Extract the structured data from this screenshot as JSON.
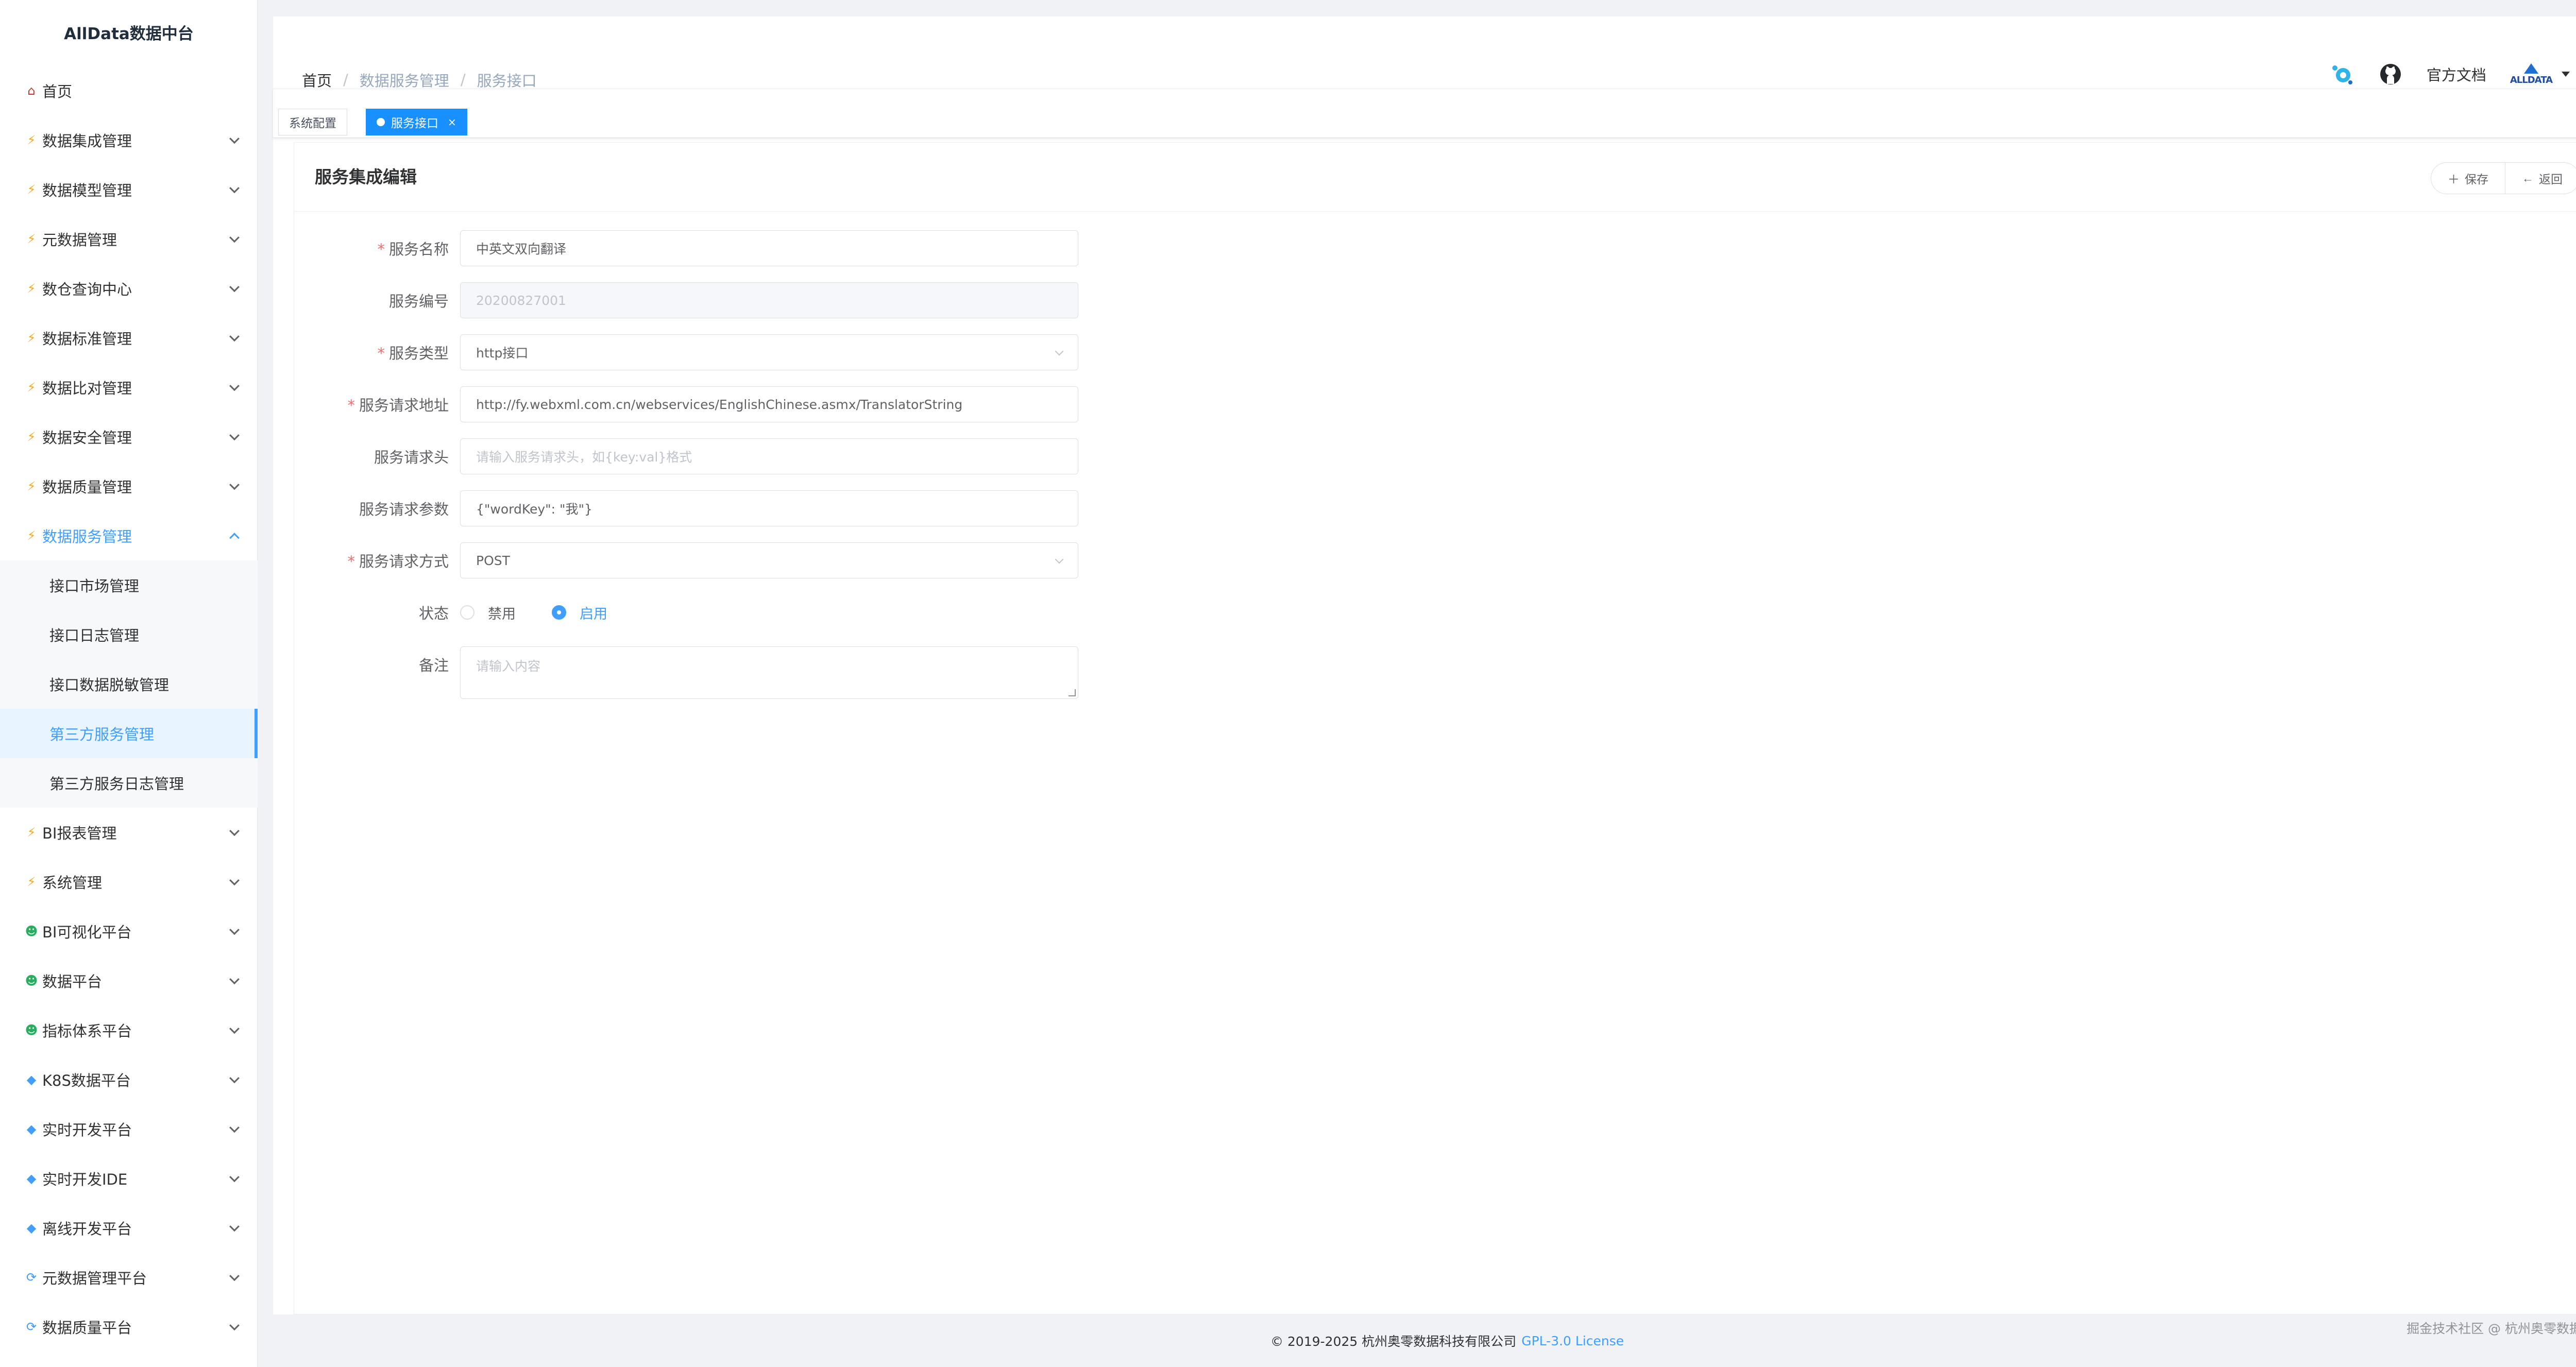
{
  "app_title": "AllData数据中台",
  "sidebar": {
    "items": [
      {
        "label": "首页",
        "icon": "home"
      },
      {
        "label": "数据集成管理",
        "icon": "bolt"
      },
      {
        "label": "数据模型管理",
        "icon": "bolt"
      },
      {
        "label": "元数据管理",
        "icon": "bolt"
      },
      {
        "label": "数仓查询中心",
        "icon": "bolt"
      },
      {
        "label": "数据标准管理",
        "icon": "bolt"
      },
      {
        "label": "数据比对管理",
        "icon": "bolt"
      },
      {
        "label": "数据安全管理",
        "icon": "bolt"
      },
      {
        "label": "数据质量管理",
        "icon": "bolt"
      },
      {
        "label": "数据服务管理",
        "icon": "bolt"
      }
    ],
    "sub_items": [
      {
        "label": "接口市场管理"
      },
      {
        "label": "接口日志管理"
      },
      {
        "label": "接口数据脱敏管理"
      },
      {
        "label": "第三方服务管理"
      },
      {
        "label": "第三方服务日志管理"
      }
    ],
    "items_after": [
      {
        "label": "BI报表管理",
        "icon": "bolt"
      },
      {
        "label": "系统管理",
        "icon": "bolt"
      },
      {
        "label": "BI可视化平台",
        "icon": "person"
      },
      {
        "label": "数据平台",
        "icon": "person"
      },
      {
        "label": "指标体系平台",
        "icon": "person"
      },
      {
        "label": "K8S数据平台",
        "icon": "gem"
      },
      {
        "label": "实时开发平台",
        "icon": "gem"
      },
      {
        "label": "实时开发IDE",
        "icon": "gem"
      },
      {
        "label": "离线开发平台",
        "icon": "gem"
      },
      {
        "label": "元数据管理平台",
        "icon": "cycle"
      },
      {
        "label": "数据质量平台",
        "icon": "cycle"
      }
    ]
  },
  "breadcrumb": [
    "首页",
    "数据服务管理",
    "服务接口"
  ],
  "header": {
    "docs_label": "官方文档",
    "avatar_text": "ALLDATA"
  },
  "tags": [
    {
      "label": "系统配置"
    },
    {
      "label": "服务接口",
      "close": "×"
    }
  ],
  "card": {
    "title": "服务集成编辑",
    "save_label": "保存",
    "back_label": "返回"
  },
  "form": {
    "service_name": {
      "label": "服务名称",
      "value": "中英文双向翻译"
    },
    "service_code": {
      "label": "服务编号",
      "value": "20200827001"
    },
    "service_type": {
      "label": "服务类型",
      "value": "http接口"
    },
    "service_url": {
      "label": "服务请求地址",
      "value": "http://fy.webxml.com.cn/webservices/EnglishChinese.asmx/TranslatorString"
    },
    "service_header": {
      "label": "服务请求头",
      "placeholder": "请输入服务请求头，如{key:val}格式"
    },
    "service_params": {
      "label": "服务请求参数",
      "value": "{\"wordKey\": \"我\"}"
    },
    "service_method": {
      "label": "服务请求方式",
      "value": "POST"
    },
    "status": {
      "label": "状态",
      "options": [
        "禁用",
        "启用"
      ],
      "selected": "启用"
    },
    "remark": {
      "label": "备注",
      "placeholder": "请输入内容"
    }
  },
  "footer": {
    "copyright": "© 2019-2025 杭州奥零数据科技有限公司",
    "license": "GPL-3.0 License"
  },
  "watermark": "掘金技术社区 @ 杭州奥零数据科技"
}
